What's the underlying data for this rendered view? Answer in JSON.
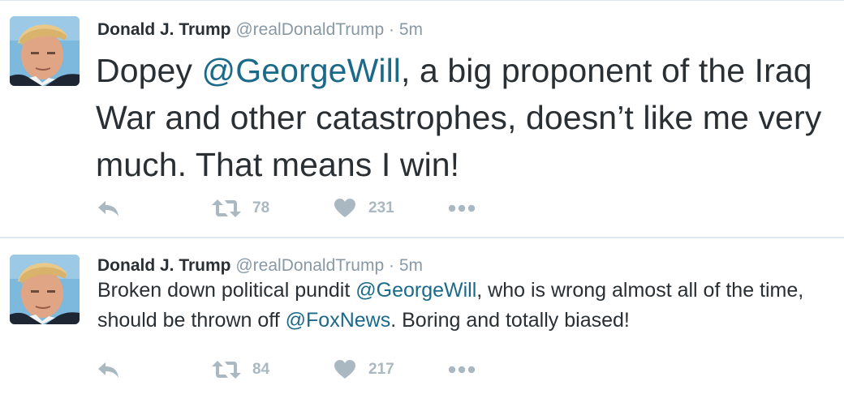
{
  "colors": {
    "text": "#292f33",
    "muted": "#8899a6",
    "link": "#1b6a8a",
    "icon": "#aab8c2",
    "divider": "#e1e8ed"
  },
  "tweets": [
    {
      "author": {
        "name": "Donald J. Trump",
        "handle": "@realDonaldTrump",
        "separator": "·",
        "time": "5m"
      },
      "text": [
        {
          "t": "Dopey "
        },
        {
          "t": "@GeorgeWill",
          "mention": true
        },
        {
          "t": ", a big proponent of the Iraq War and other catastrophes, doesn’t like me very much. That means I win!"
        }
      ],
      "retweets": "78",
      "likes": "231",
      "icons": {
        "reply": "reply-icon",
        "retweet": "retweet-icon",
        "like": "heart-icon",
        "more": "more-dots-icon"
      }
    },
    {
      "author": {
        "name": "Donald J. Trump",
        "handle": "@realDonaldTrump",
        "separator": "·",
        "time": "5m"
      },
      "text": [
        {
          "t": "Broken down political pundit "
        },
        {
          "t": "@GeorgeWill",
          "mention": true
        },
        {
          "t": ", who is wrong almost all of the time, should be thrown off "
        },
        {
          "t": "@FoxNews",
          "mention": true
        },
        {
          "t": ". Boring and totally biased!"
        }
      ],
      "retweets": "84",
      "likes": "217",
      "icons": {
        "reply": "reply-icon",
        "retweet": "retweet-icon",
        "like": "heart-icon",
        "more": "more-dots-icon"
      }
    }
  ]
}
